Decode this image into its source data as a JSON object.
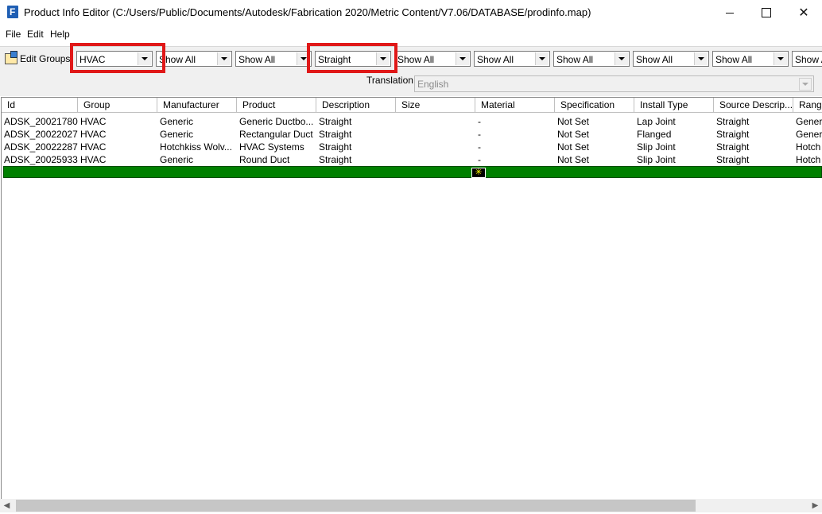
{
  "window": {
    "title": "Product Info Editor (C:/Users/Public/Documents/Autodesk/Fabrication 2020/Metric Content/V7.06/DATABASE/prodinfo.map)",
    "icon_letter": "F",
    "minimize": "—",
    "close": "✕"
  },
  "menu": [
    "File",
    "Edit",
    "Help"
  ],
  "toolbar": {
    "edit_groups_label": "Edit Groups",
    "filters": [
      "HVAC",
      "Show All",
      "Show All",
      "Straight",
      "Show All",
      "Show All",
      "Show All",
      "Show All",
      "Show All",
      "Show All"
    ],
    "translation_label": "Translation",
    "translation_value": "English"
  },
  "grid": {
    "columns": [
      "Id",
      "Group",
      "Manufacturer",
      "Product",
      "Description",
      "Size",
      "Material",
      "Specification",
      "Install Type",
      "Source Descrip...",
      "Rang"
    ],
    "rows": [
      [
        "ADSK_20021780",
        "HVAC",
        "Generic",
        "Generic Ductbo...",
        "Straight",
        "",
        "-",
        "Not Set",
        "Lap Joint",
        "Straight",
        "Gener"
      ],
      [
        "ADSK_20022027",
        "HVAC",
        "Generic",
        "Rectangular Duct",
        "Straight",
        "",
        "-",
        "Not Set",
        "Flanged",
        "Straight",
        "Gener"
      ],
      [
        "ADSK_20022287",
        "HVAC",
        "Hotchkiss Wolv...",
        "HVAC Systems",
        "Straight",
        "",
        "-",
        "Not Set",
        "Slip Joint",
        "Straight",
        "Hotch"
      ],
      [
        "ADSK_20025933",
        "HVAC",
        "Generic",
        "Round Duct",
        "Straight",
        "",
        "-",
        "Not Set",
        "Slip Joint",
        "Straight",
        "Hotch"
      ]
    ],
    "new_row_marker": "✳"
  },
  "colors": {
    "highlight": "#e01818",
    "new_row": "#008000"
  }
}
